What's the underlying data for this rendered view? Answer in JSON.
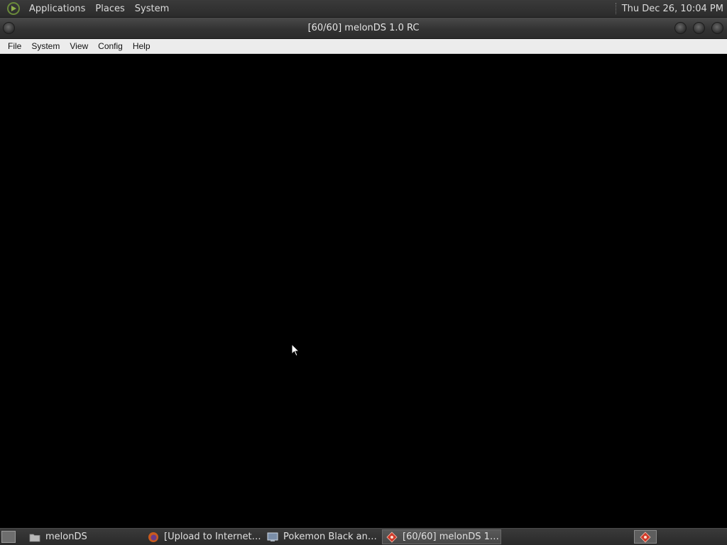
{
  "top_panel": {
    "menu": [
      "Applications",
      "Places",
      "System"
    ],
    "clock": "Thu Dec 26, 10:04 PM"
  },
  "window": {
    "title": "[60/60] melonDS 1.0 RC"
  },
  "menubar": {
    "items": [
      "File",
      "System",
      "View",
      "Config",
      "Help"
    ]
  },
  "taskbar": {
    "tasks": [
      {
        "label": "melonDS",
        "icon": "folder-icon"
      },
      {
        "label": "[Upload to Internet ...",
        "icon": "firefox-icon"
      },
      {
        "label": "Pokemon Black and...",
        "icon": "system-monitor-icon"
      },
      {
        "label": "[60/60] melonDS 1....",
        "icon": "melonds-icon"
      }
    ],
    "active_task": "[60/60] melonDS 1...."
  },
  "colors": {
    "panel_bg": "#2e2e2e",
    "menubar_bg": "#ececec",
    "screen_bg": "#000000",
    "menu_accent": "#6a8a3a"
  }
}
